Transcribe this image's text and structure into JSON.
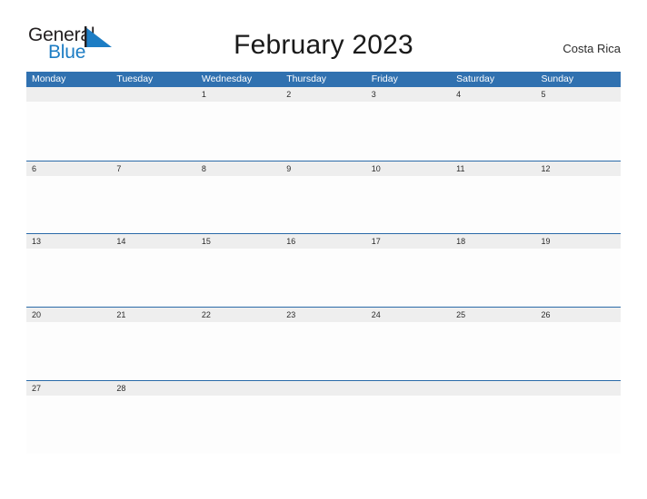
{
  "brand": {
    "name_part1": "General",
    "name_part2": "Blue",
    "triangle_color": "#1d7dc4",
    "text_color_1": "#231f20",
    "text_color_2": "#1d7dc4"
  },
  "header": {
    "title": "February 2023",
    "location": "Costa Rica"
  },
  "theme": {
    "header_blue": "#3071b0",
    "separator_blue": "#2a6aa8",
    "band_gray": "#eeeeee",
    "cell_white": "#fdfdfd"
  },
  "calendar": {
    "weekdays": [
      "Monday",
      "Tuesday",
      "Wednesday",
      "Thursday",
      "Friday",
      "Saturday",
      "Sunday"
    ],
    "weeks": [
      [
        "",
        "",
        "1",
        "2",
        "3",
        "4",
        "5"
      ],
      [
        "6",
        "7",
        "8",
        "9",
        "10",
        "11",
        "12"
      ],
      [
        "13",
        "14",
        "15",
        "16",
        "17",
        "18",
        "19"
      ],
      [
        "20",
        "21",
        "22",
        "23",
        "24",
        "25",
        "26"
      ],
      [
        "27",
        "28",
        "",
        "",
        "",
        "",
        ""
      ]
    ]
  }
}
